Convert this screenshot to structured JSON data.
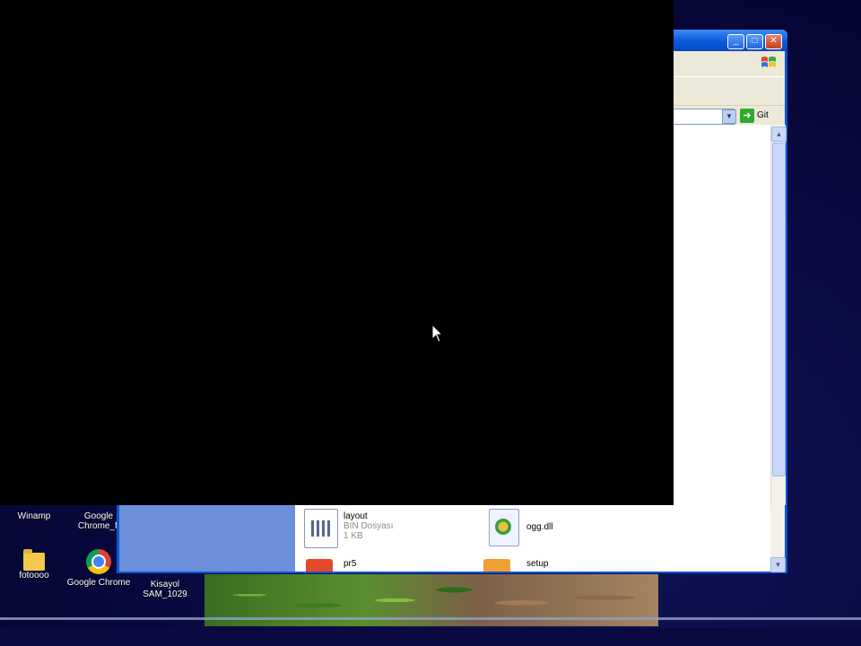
{
  "desktop": {
    "icons": [
      {
        "label": "Winamp"
      },
      {
        "label": "Google Chrome_fi"
      },
      {
        "label": "fotoooo"
      },
      {
        "label": "Google Chrome"
      },
      {
        "label": "Kisayol SAM_1029"
      }
    ]
  },
  "explorer": {
    "go_label": "Git",
    "files": [
      {
        "name": "layout",
        "type": "BIN Dosyası",
        "size": "1 KB"
      },
      {
        "name": "ogg.dll"
      },
      {
        "name": "pr5"
      },
      {
        "name": "setup"
      }
    ]
  },
  "colors": {
    "desktop_bg": "#07073a",
    "xp_blue": "#0a54d8",
    "tasks_panel": "#6b8fd8"
  }
}
